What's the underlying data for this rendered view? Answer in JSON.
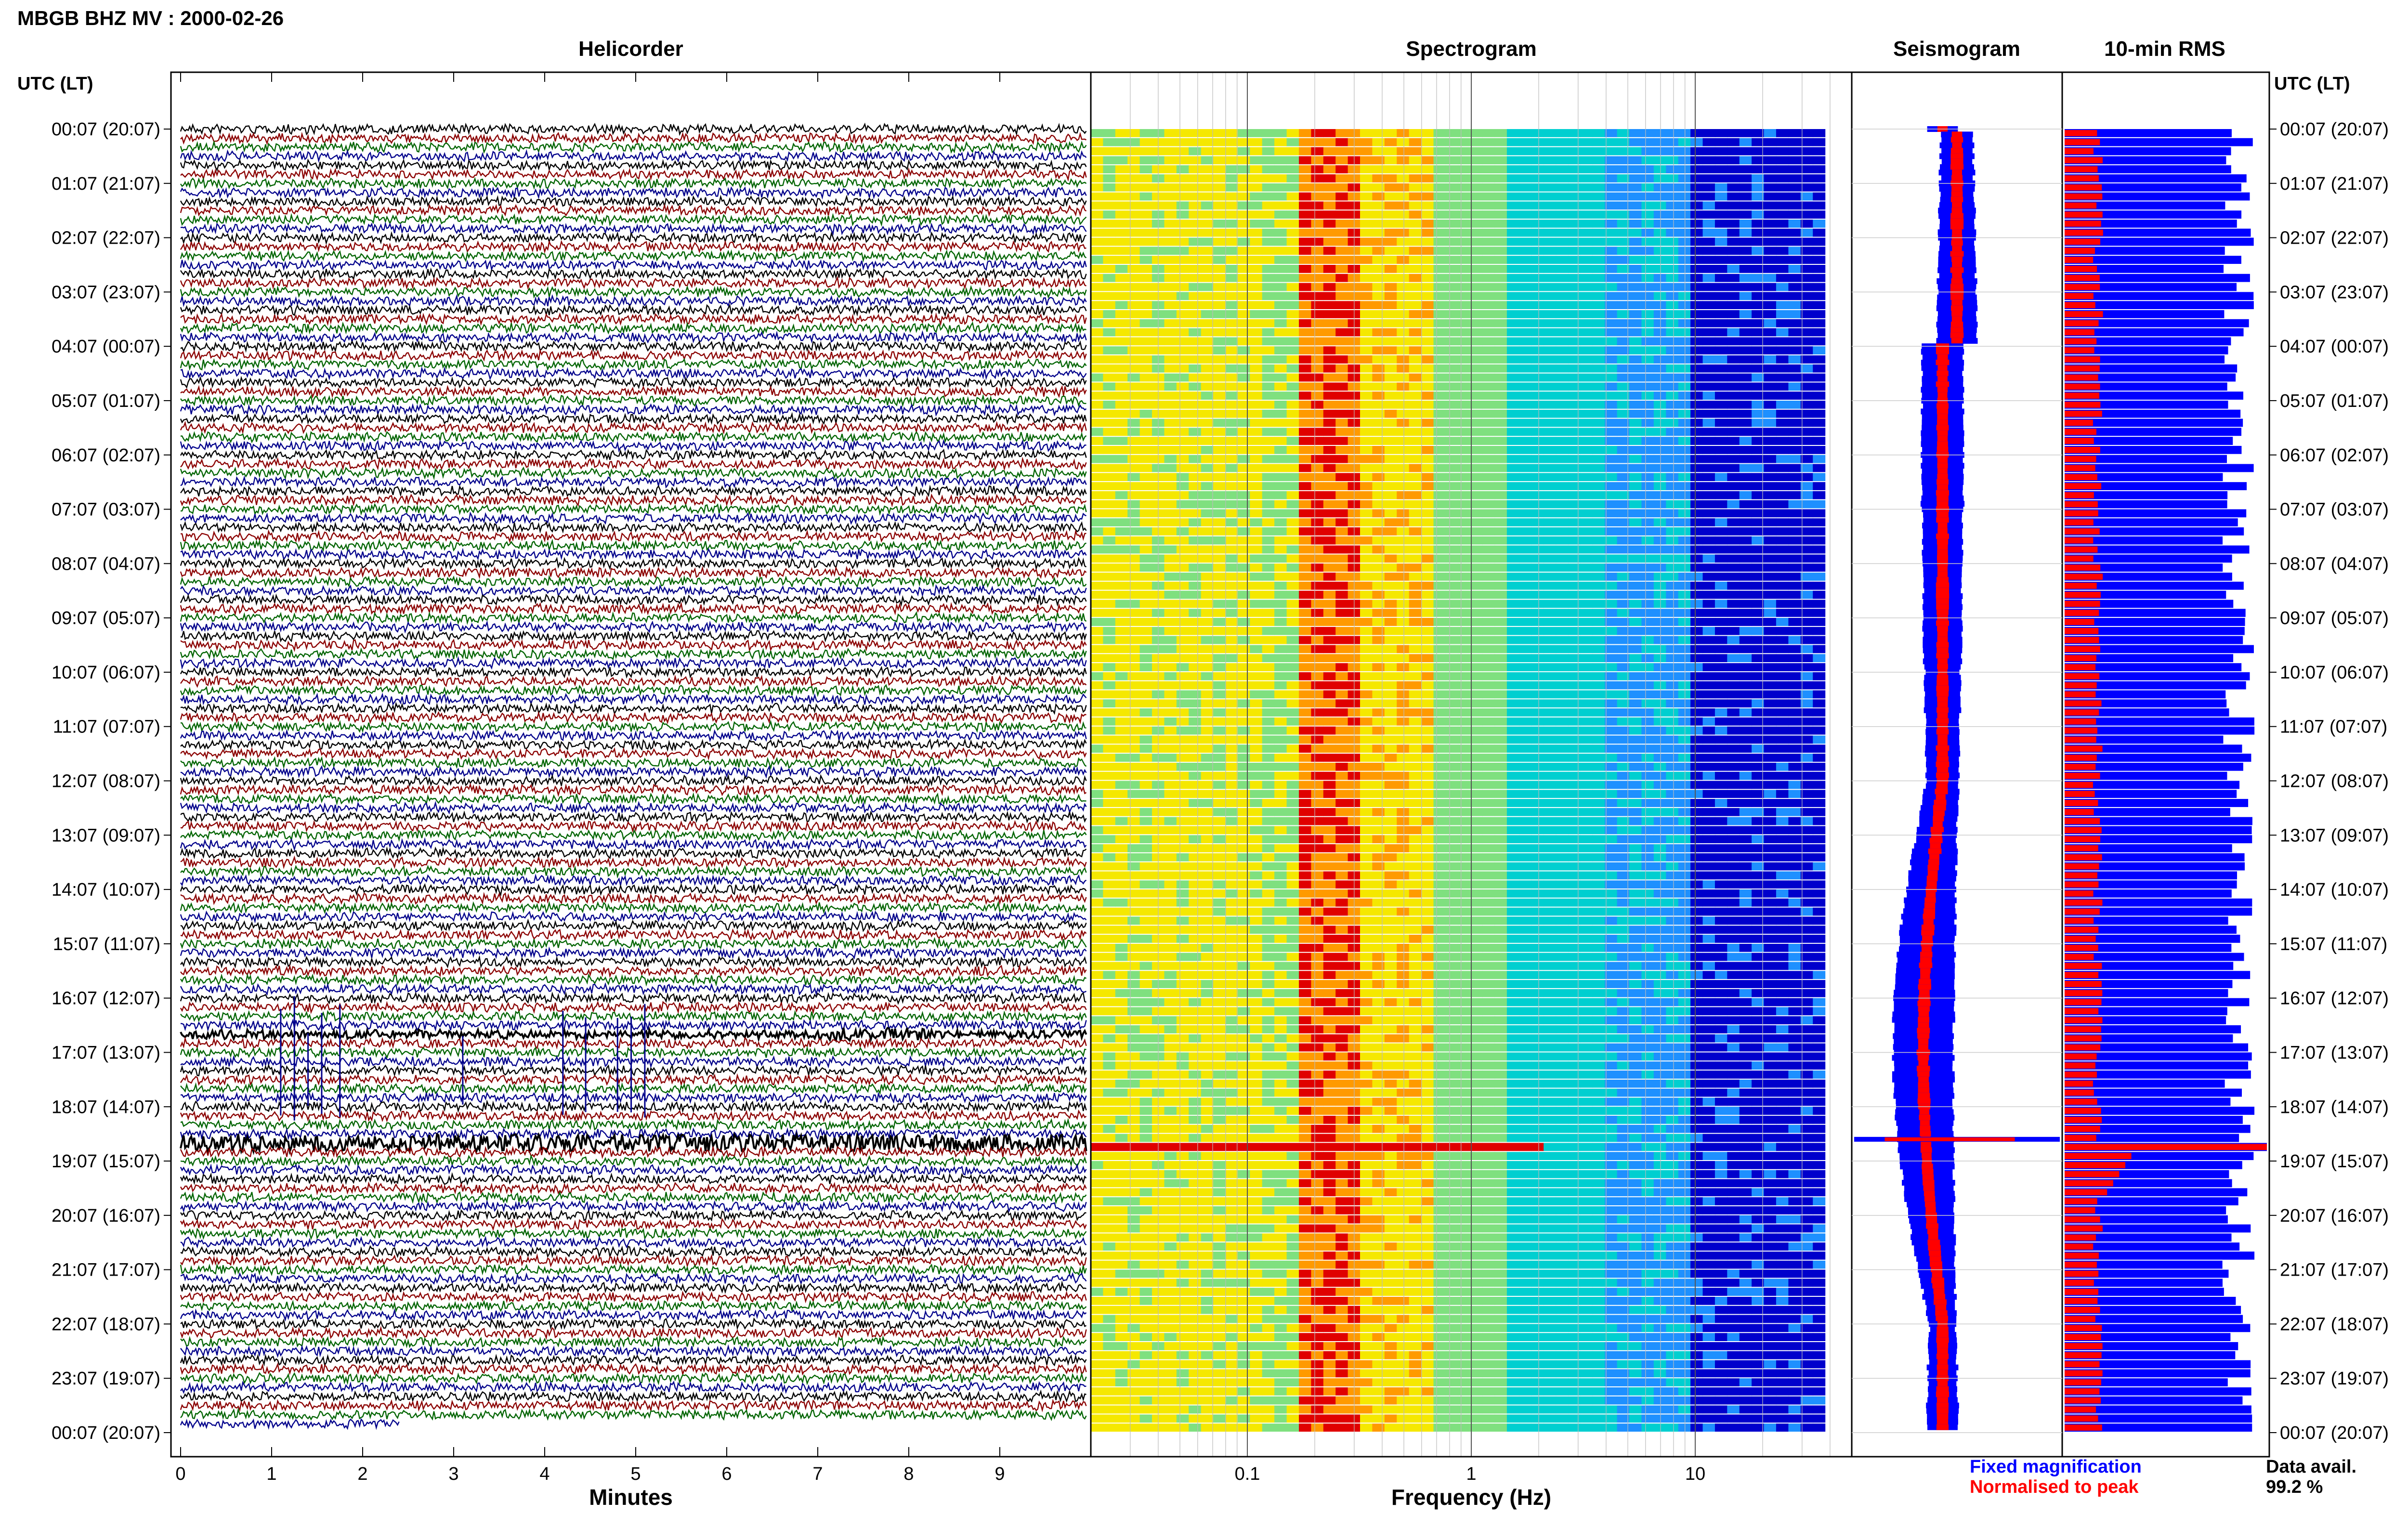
{
  "header": {
    "title": "MBGB BHZ MV : 2000-02-26"
  },
  "chart_data": [
    {
      "type": "line",
      "panel": "helicorder",
      "title": "Helicorder",
      "xlabel": "Minutes",
      "ylabel": "UTC (LT)",
      "xlim": [
        0,
        10
      ],
      "x_ticks": [
        "0",
        "1",
        "2",
        "3",
        "4",
        "5",
        "6",
        "7",
        "8",
        "9"
      ],
      "y_tick_labels": [
        "00:07 (20:07)",
        "01:07 (21:07)",
        "02:07 (22:07)",
        "03:07 (23:07)",
        "04:07 (00:07)",
        "05:07 (01:07)",
        "06:07 (02:07)",
        "07:07 (03:07)",
        "08:07 (04:07)",
        "09:07 (05:07)",
        "10:07 (06:07)",
        "11:07 (07:07)",
        "12:07 (08:07)",
        "13:07 (09:07)",
        "14:07 (10:07)",
        "15:07 (11:07)",
        "16:07 (12:07)",
        "17:07 (13:07)",
        "18:07 (14:07)",
        "19:07 (15:07)",
        "20:07 (16:07)",
        "21:07 (17:07)",
        "22:07 (18:07)",
        "23:07 (19:07)",
        "00:07 (20:07)"
      ],
      "trace_colors": [
        "#000000",
        "#8b0000",
        "#006400",
        "#00008b"
      ],
      "traces_per_hour": 6,
      "highlight_events": [
        {
          "trace_index": 112,
          "label": "",
          "minute_start": 0,
          "minute_end": 10
        },
        {
          "trace_index": 100,
          "minute_start": 7.1,
          "minute_end": 8.2
        }
      ]
    },
    {
      "type": "heatmap",
      "panel": "spectrogram",
      "title": "Spectrogram",
      "xlabel": "Frequency (Hz)",
      "x_scale": "log",
      "xlim": [
        0.02,
        50
      ],
      "x_ticks": [
        "0.1",
        "1",
        "10"
      ],
      "colormap": [
        "#0000cc",
        "#1e90ff",
        "#00cfd0",
        "#7fe07f",
        "#f5e800",
        "#ff9a00",
        "#e00000"
      ]
    },
    {
      "type": "area",
      "panel": "seismogram",
      "title": "Seismogram",
      "series": [
        {
          "name": "Fixed magnification",
          "color": "#0000ff"
        },
        {
          "name": "Normalised to peak",
          "color": "#ff0000"
        }
      ]
    },
    {
      "type": "bar",
      "panel": "rms",
      "title": "10-min RMS",
      "ylabel": "UTC (LT)",
      "series_colors": {
        "fixed": "#0000ff",
        "normalised": "#ff0000"
      }
    }
  ],
  "legend": {
    "fixed_label": "Fixed magnification",
    "normalised_label": "Normalised to peak"
  },
  "availability": {
    "label": "Data avail.",
    "value": "99.2 %"
  }
}
